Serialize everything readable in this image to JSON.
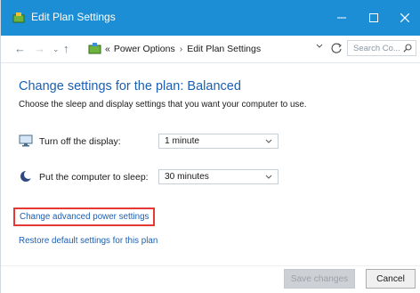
{
  "window": {
    "title": "Edit Plan Settings"
  },
  "address": {
    "prefix": "«",
    "crumbs": [
      "Power Options",
      "Edit Plan Settings"
    ],
    "search_placeholder": "Search Co..."
  },
  "main": {
    "heading": "Change settings for the plan: Balanced",
    "subtitle": "Choose the sleep and display settings that you want your computer to use.",
    "display_row": {
      "label": "Turn off the display:",
      "value": "1 minute"
    },
    "sleep_row": {
      "label": "Put the computer to sleep:",
      "value": "30 minutes"
    },
    "advanced_link": "Change advanced power settings",
    "restore_link": "Restore default settings for this plan"
  },
  "footer": {
    "save_label": "Save changes",
    "cancel_label": "Cancel"
  },
  "colors": {
    "titlebar": "#1b8ed6",
    "link": "#1b5fb4",
    "highlight_box": "#e53935"
  },
  "icons": {
    "title": "power-options-icon",
    "display": "monitor-icon",
    "sleep": "moon-icon"
  }
}
